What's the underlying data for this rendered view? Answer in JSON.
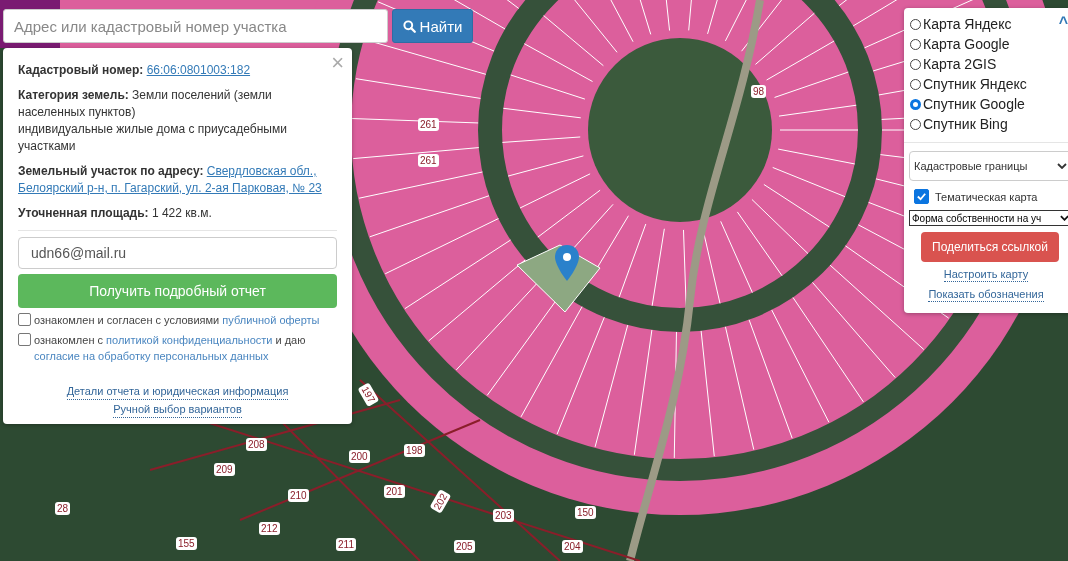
{
  "search": {
    "placeholder": "Адрес или кадастровый номер участка",
    "button": "Найти"
  },
  "info_panel": {
    "close": "×",
    "fields": [
      {
        "label": "Кадастровый номер:",
        "value": "66:06:0801003:182",
        "kind": "link"
      },
      {
        "label": "Категория земель:",
        "value": "Земли поселений (земли населенных пунктов)\nиндивидуальные жилые дома с приусадебными участками",
        "kind": "text"
      },
      {
        "label": "Земельный участок по адресу:",
        "value_lines": [
          "Свердловская обл.,",
          "Белоярский р-н, п. Гагарский, ул. 2-ая Парковая, № 23"
        ],
        "kind": "links"
      },
      {
        "label": "Уточненная площадь:",
        "value": "1 422 кв.м.",
        "kind": "text"
      }
    ],
    "email": "udn66@mail.ru",
    "submit": "Получить подробный отчет",
    "agreements": [
      {
        "checked": false,
        "parts": [
          {
            "text": "ознакомлен и согласен с условиями",
            "kind": "text"
          },
          {
            "text": "публичной оферты",
            "kind": "link"
          }
        ]
      },
      {
        "checked": false,
        "parts": [
          {
            "text": "ознакомлен с",
            "kind": "text"
          },
          {
            "text": "политикой конфиденциальности",
            "kind": "link"
          },
          {
            "text": "и даю",
            "kind": "text"
          },
          {
            "text": "согласие на обработку персональных данных",
            "kind": "link"
          }
        ]
      }
    ],
    "links": [
      "Детали отчета и юридическая информация",
      "Ручной выбор вариантов"
    ]
  },
  "layers_panel": {
    "collapse": "^",
    "base_maps": [
      {
        "label": "Карта Яндекс",
        "selected": false
      },
      {
        "label": "Карта Google",
        "selected": false
      },
      {
        "label": "Карта 2GIS",
        "selected": false
      },
      {
        "label": "Спутник Яндекс",
        "selected": false
      },
      {
        "label": "Спутник Google",
        "selected": true
      },
      {
        "label": "Спутник Bing",
        "selected": false
      }
    ],
    "overlay_select": "Кадастровые границы",
    "thematic": {
      "label": "Тематическая карта",
      "checked": true
    },
    "thematic_select": "Форма собственности на уч",
    "share": "Поделиться ссылкой",
    "links": [
      "Настроить карту",
      "Показать обозначения"
    ]
  },
  "map_labels": [
    "261",
    "261",
    "98",
    "197",
    "208",
    "209",
    "210",
    "200",
    "198",
    "201",
    "202",
    "203",
    "150",
    "212",
    "155",
    "211",
    "205",
    "204",
    "28"
  ]
}
